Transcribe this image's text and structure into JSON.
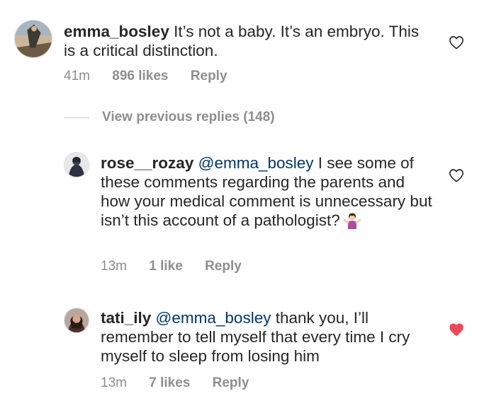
{
  "comments": [
    {
      "username": "emma_bosley",
      "mention": "",
      "text": "It’s not a baby. It’s an embryo. This is a critical distinction.",
      "time": "41m",
      "likes": "896 likes",
      "reply": "Reply",
      "liked": false
    },
    {
      "username": "rose__rozay",
      "mention": "@emma_bosley",
      "text": "I see some of these comments regarding the parents and how your medical comment is unnecessary but isn’t this account of a pathologist?",
      "emoji": "person-shrugging-emoji",
      "time": "13m",
      "likes": "1 like",
      "reply": "Reply",
      "liked": false
    },
    {
      "username": "tati_ily",
      "mention": "@emma_bosley",
      "text": "thank you, I’ll remember to tell myself that every time I cry myself to sleep from losing him",
      "time": "13m",
      "likes": "7 likes",
      "reply": "Reply",
      "liked": true
    }
  ],
  "view_previous_replies": "View previous replies (148)",
  "colors": {
    "text": "#262626",
    "meta": "#8e8e8e",
    "mention": "#00376b",
    "liked_heart": "#ed4956"
  },
  "icons": {
    "heart_outline": "heart-outline-icon",
    "heart_filled": "heart-filled-icon"
  }
}
